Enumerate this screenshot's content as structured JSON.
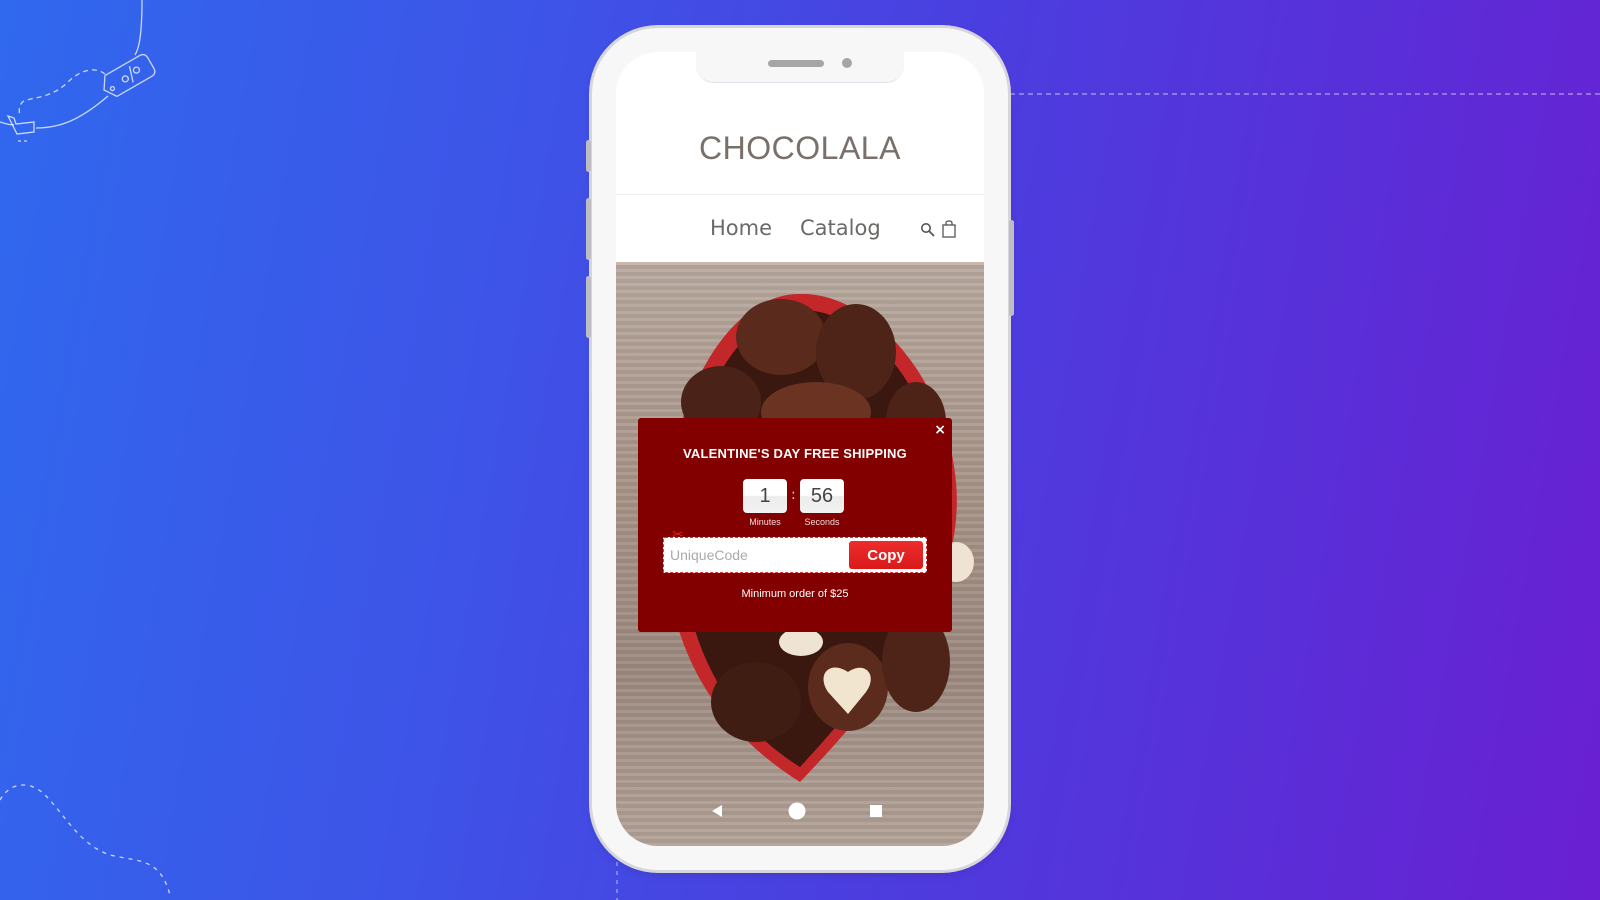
{
  "background": {
    "gradient_start": "#3068ee",
    "gradient_end": "#6a1fd2"
  },
  "decorations": {
    "tag_icon": "percent-tag-icon",
    "cart_icon": "shopping-cart-icon"
  },
  "store": {
    "brand": "CHOCOLALA",
    "nav": [
      {
        "label": "Home"
      },
      {
        "label": "Catalog"
      }
    ],
    "icons": {
      "search": "search-icon",
      "cart": "shopping-bag-icon"
    }
  },
  "popup": {
    "title": "VALENTINE'S DAY FREE SHIPPING",
    "close_glyph": "×",
    "timer": {
      "minutes": "1",
      "seconds": "56",
      "separator": ":",
      "minutes_label": "Minutes",
      "seconds_label": "Seconds"
    },
    "code": {
      "value": "",
      "placeholder": "UniqueCode",
      "scissors_glyph": "✂"
    },
    "copy_label": "Copy",
    "note": "Minimum order of $25",
    "colors": {
      "background": "#820000",
      "button": "#e52424"
    }
  },
  "android_nav": {
    "back": "back-triangle-icon",
    "home": "home-circle-icon",
    "recents": "recents-square-icon"
  }
}
